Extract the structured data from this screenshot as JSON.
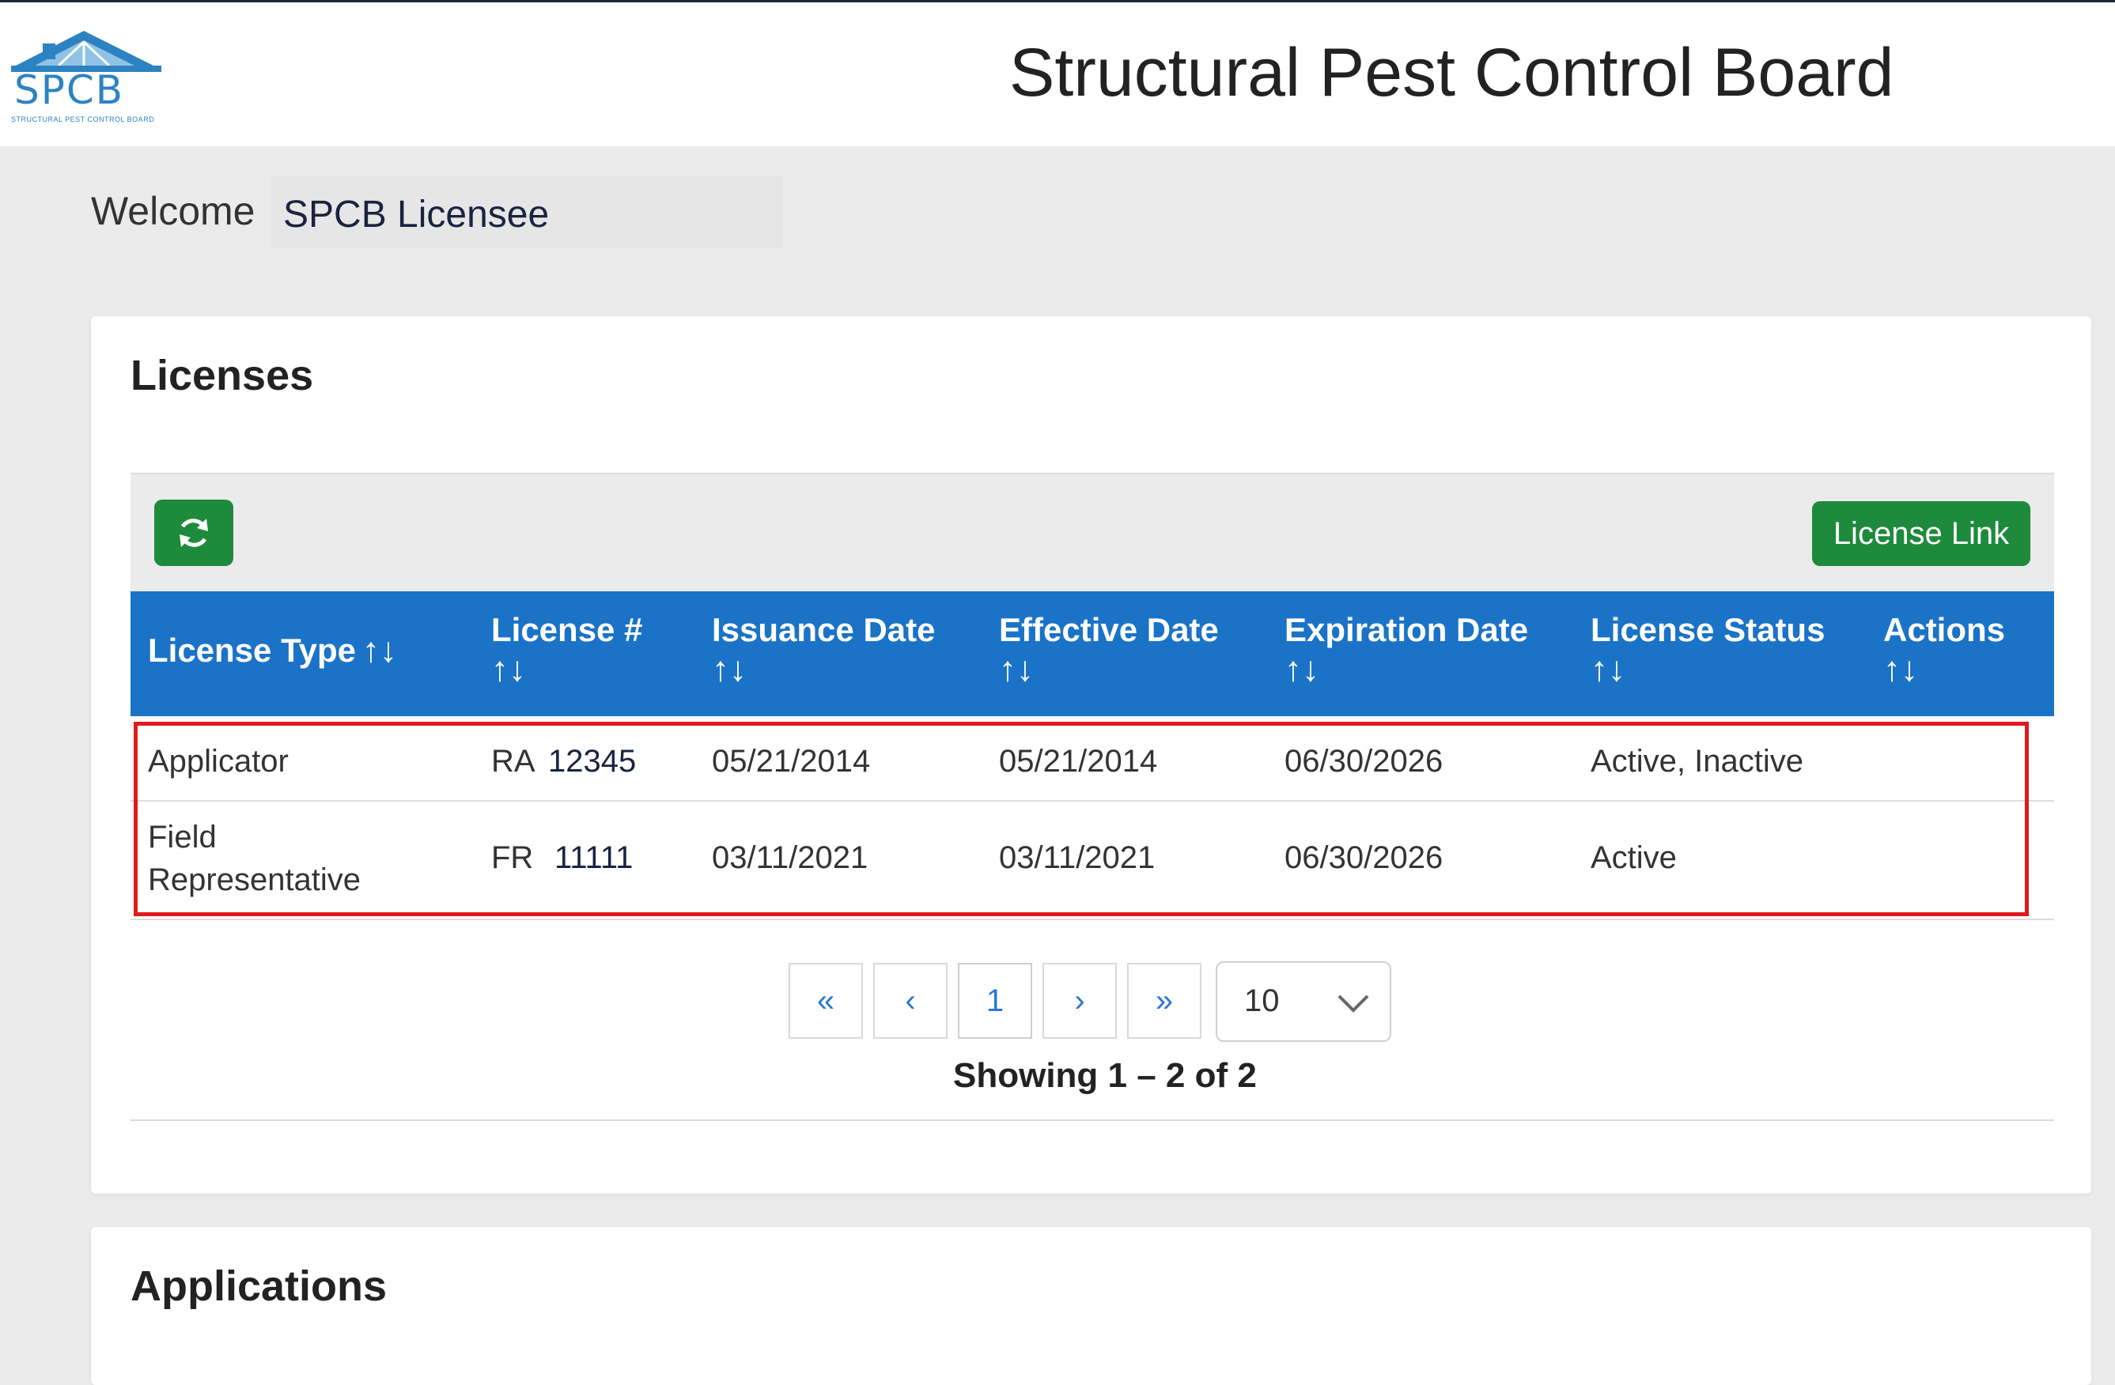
{
  "header": {
    "logo": {
      "abbr": "SPCB",
      "tagline": "STRUCTURAL PEST CONTROL BOARD"
    },
    "title": "Structural Pest Control Board"
  },
  "welcome": {
    "label": "Welcome",
    "name": "SPCB Licensee"
  },
  "licenses": {
    "title": "Licenses",
    "license_link_label": "License Link",
    "sort_glyph": "↑↓",
    "columns": [
      "License Type",
      "License #",
      "Issuance Date",
      "Effective Date",
      "Expiration Date",
      "License Status",
      "Actions"
    ],
    "rows": [
      {
        "type_line1": "Applicator",
        "type_line2": "",
        "prefix": "RA",
        "number": "12345",
        "issuance": "05/21/2014",
        "effective": "05/21/2014",
        "expiration": "06/30/2026",
        "status": "Active, Inactive",
        "actions": ""
      },
      {
        "type_line1": "Field",
        "type_line2": "Representative",
        "prefix": "FR",
        "number": "11111",
        "issuance": "03/11/2021",
        "effective": "03/11/2021",
        "expiration": "06/30/2026",
        "status": "Active",
        "actions": ""
      }
    ],
    "pagination": {
      "first": "«",
      "prev": "‹",
      "page": "1",
      "next": "›",
      "last": "»",
      "per_page": "10",
      "showing": "Showing 1 – 2 of 2"
    }
  },
  "applications": {
    "title": "Applications"
  },
  "colors": {
    "brand_blue": "#1a73c6",
    "brand_green": "#1e8a3c",
    "highlight_red": "#e01a1a",
    "logo_blue": "#2d82c2"
  },
  "icons": {
    "refresh": "refresh-icon",
    "chevron": "chevron-down-icon"
  }
}
